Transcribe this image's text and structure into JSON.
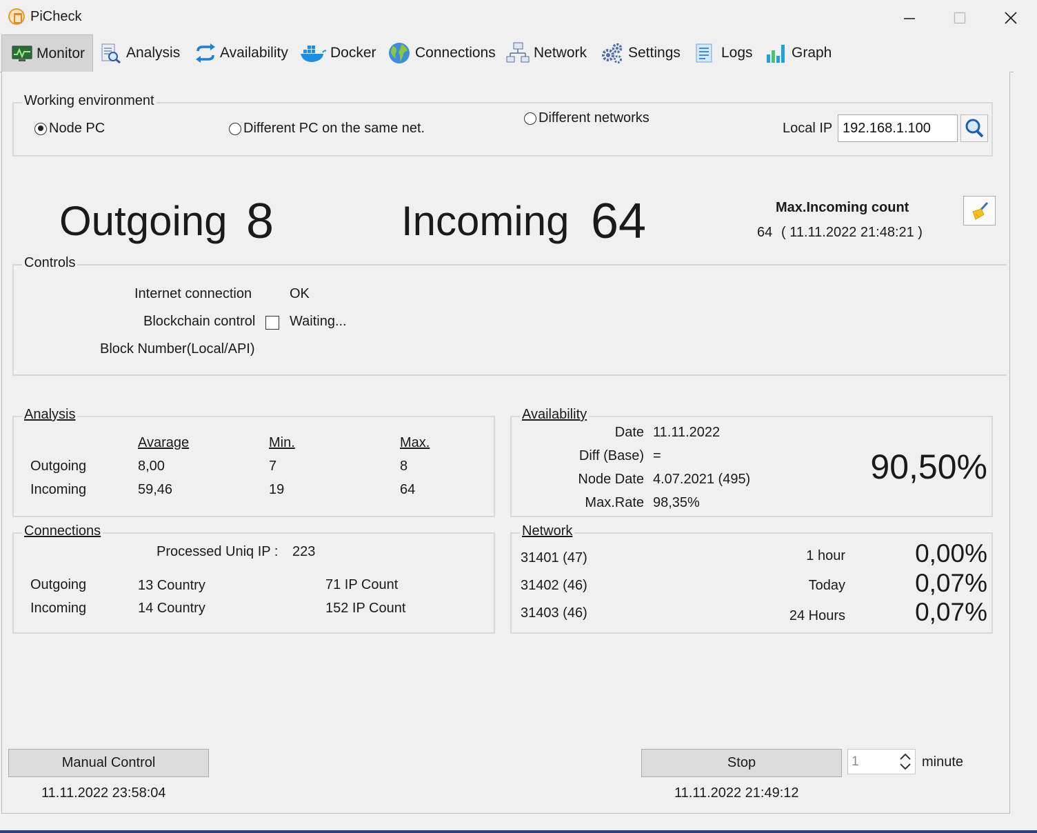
{
  "window": {
    "title": "PiCheck"
  },
  "tabs": [
    {
      "label": "Monitor",
      "icon": "monitor-icon"
    },
    {
      "label": "Analysis",
      "icon": "analysis-icon"
    },
    {
      "label": "Availability",
      "icon": "sync-arrows-icon"
    },
    {
      "label": "Docker",
      "icon": "docker-icon"
    },
    {
      "label": "Connections",
      "icon": "globe-icon"
    },
    {
      "label": "Network",
      "icon": "network-icon"
    },
    {
      "label": "Settings",
      "icon": "gears-icon"
    },
    {
      "label": "Logs",
      "icon": "logs-icon"
    },
    {
      "label": "Graph",
      "icon": "bar-graph-icon"
    }
  ],
  "environment": {
    "legend": "Working environment",
    "options": [
      "Node PC",
      "Different PC on the same net.",
      "Different networks"
    ],
    "selected": "Node PC",
    "local_ip_label": "Local IP",
    "local_ip_value": "192.168.1.100"
  },
  "counts": {
    "outgoing_label": "Outgoing",
    "outgoing_value": "8",
    "incoming_label": "Incoming",
    "incoming_value": "64",
    "max_incoming_title": "Max.Incoming count",
    "max_incoming_value": "64",
    "max_incoming_time": "( 11.11.2022 21:48:21 )"
  },
  "controls": {
    "legend": "Controls",
    "internet_label": "Internet connection",
    "internet_status": "OK",
    "blockchain_label": "Blockchain control",
    "blockchain_status": "Waiting...",
    "block_number_label": "Block Number(Local/API)"
  },
  "analysis": {
    "legend": "Analysis",
    "headers": [
      "Avarage",
      "Min.",
      "Max."
    ],
    "rows": [
      {
        "label": "Outgoing",
        "avg": "8,00",
        "min": "7",
        "max": "8"
      },
      {
        "label": "Incoming",
        "avg": "59,46",
        "min": "19",
        "max": "64"
      }
    ]
  },
  "availability": {
    "legend": "Availability",
    "date_label": "Date",
    "date_value": "11.11.2022",
    "diff_label": "Diff (Base)",
    "diff_value": "=",
    "node_date_label": "Node Date",
    "node_date_value": "4.07.2021 (495)",
    "max_rate_label": "Max.Rate",
    "max_rate_value": "98,35%",
    "percent": "90,50%"
  },
  "connections": {
    "legend": "Connections",
    "processed_label": "Processed Uniq IP :",
    "processed_value": "223",
    "rows": [
      {
        "label": "Outgoing",
        "country": "13 Country",
        "ip": "71 IP Count"
      },
      {
        "label": "Incoming",
        "country": "14 Country",
        "ip": "152 IP Count"
      }
    ]
  },
  "network": {
    "legend": "Network",
    "ports": [
      "31401 (47)",
      "31402 (46)",
      "31403 (46)"
    ],
    "periods": [
      {
        "label": "1 hour",
        "value": "0,00%"
      },
      {
        "label": "Today",
        "value": "0,07%"
      },
      {
        "label": "24 Hours",
        "value": "0,07%"
      }
    ]
  },
  "footer": {
    "manual_button": "Manual Control",
    "manual_time": "11.11.2022 23:58:04",
    "stop_button": "Stop",
    "interval_value": "1",
    "interval_unit": "minute",
    "stop_time": "11.11.2022 21:49:12"
  }
}
